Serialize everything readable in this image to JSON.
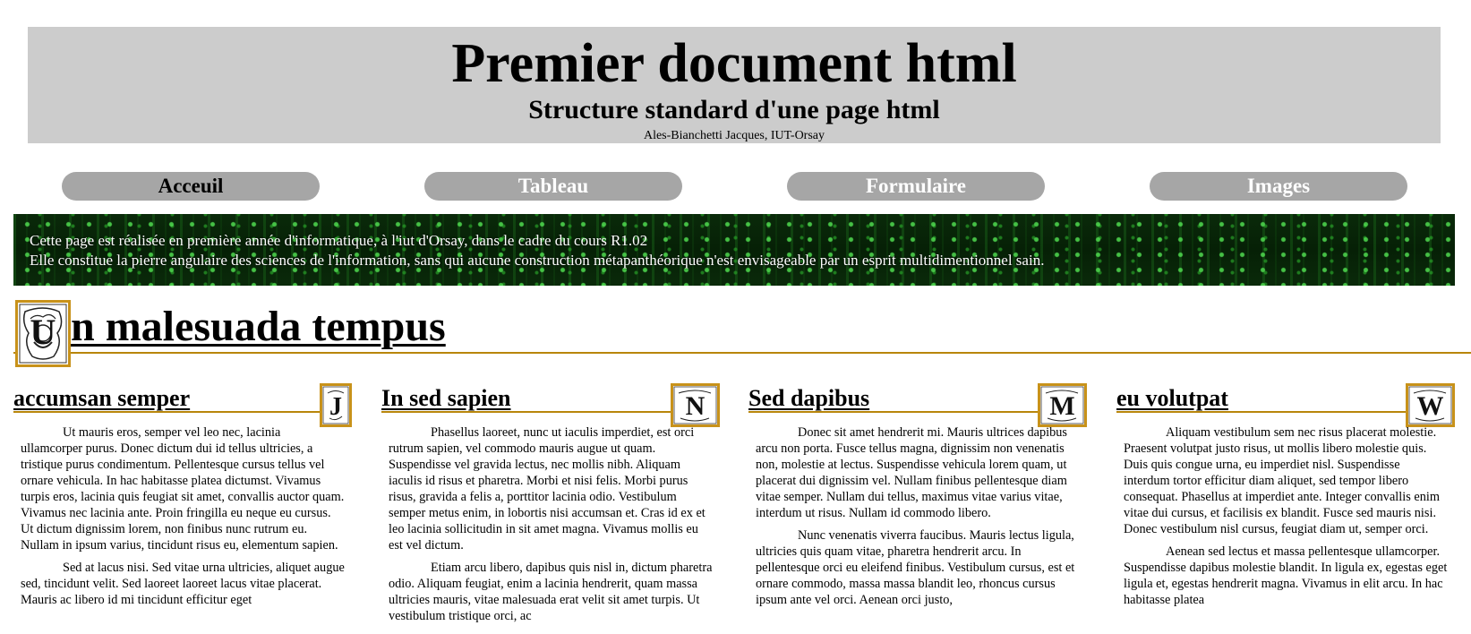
{
  "header": {
    "title": "Premier document html",
    "subtitle": "Structure standard d'une page html",
    "author": "Ales-Bianchetti Jacques, IUT-Orsay"
  },
  "nav": {
    "items": [
      {
        "label": "Acceuil",
        "active": true
      },
      {
        "label": "Tableau",
        "active": false
      },
      {
        "label": "Formulaire",
        "active": false
      },
      {
        "label": "Images",
        "active": false
      }
    ]
  },
  "banner": {
    "line1": "Cette page est réalisée en première année d'informatique, à l'iut d'Orsay, dans le cadre du cours R1.02",
    "line2": "Elle constitue la pierre angulaire des sciences de l'information, sans qui aucune construction métapanthéorique n'est envisageable par un esprit multidimentionnel sain."
  },
  "main": {
    "dropcap": "U",
    "title": "n malesuada tempus"
  },
  "columns": [
    {
      "title": "accumsan semper",
      "dropcap": "J",
      "paragraphs": [
        "Ut mauris eros, semper vel leo nec, lacinia ullamcorper purus. Donec dictum dui id tellus ultricies, a tristique purus condimentum. Pellentesque cursus tellus vel ornare vehicula. In hac habitasse platea dictumst. Vivamus turpis eros, lacinia quis feugiat sit amet, convallis auctor quam. Vivamus nec lacinia ante. Proin fringilla eu neque eu cursus. Ut dictum dignissim lorem, non finibus nunc rutrum eu. Nullam in ipsum varius, tincidunt risus eu, elementum sapien.",
        "Sed at lacus nisi. Sed vitae urna ultricies, aliquet augue sed, tincidunt velit. Sed laoreet laoreet lacus vitae placerat. Mauris ac libero id mi tincidunt efficitur eget"
      ]
    },
    {
      "title": "In sed sapien",
      "dropcap": "N",
      "paragraphs": [
        "Phasellus laoreet, nunc ut iaculis imperdiet, est orci rutrum sapien, vel commodo mauris augue ut quam. Suspendisse vel gravida lectus, nec mollis nibh. Aliquam iaculis id risus et pharetra. Morbi et nisi felis. Morbi purus risus, gravida a felis a, porttitor lacinia odio. Vestibulum semper metus enim, in lobortis nisi accumsan et. Cras id ex et leo lacinia sollicitudin in sit amet magna. Vivamus mollis eu est vel dictum.",
        "Etiam arcu libero, dapibus quis nisl in, dictum pharetra odio. Aliquam feugiat, enim a lacinia hendrerit, quam massa ultricies mauris, vitae malesuada erat velit sit amet turpis. Ut vestibulum tristique orci, ac"
      ]
    },
    {
      "title": "Sed dapibus",
      "dropcap": "M",
      "paragraphs": [
        "Donec sit amet hendrerit mi. Mauris ultrices dapibus arcu non porta. Fusce tellus magna, dignissim non venenatis non, molestie at lectus. Suspendisse vehicula lorem quam, ut placerat dui dignissim vel. Nullam finibus pellentesque diam vitae semper. Nullam dui tellus, maximus vitae varius vitae, interdum ut risus. Nullam id commodo libero.",
        "Nunc venenatis viverra faucibus. Mauris lectus ligula, ultricies quis quam vitae, pharetra hendrerit arcu. In pellentesque orci eu eleifend finibus. Vestibulum cursus, est et ornare commodo, massa massa blandit leo, rhoncus cursus ipsum ante vel orci. Aenean orci justo,"
      ]
    },
    {
      "title": "eu volutpat",
      "dropcap": "W",
      "paragraphs": [
        "Aliquam vestibulum sem nec risus placerat molestie. Praesent volutpat justo risus, ut mollis libero molestie quis. Duis quis congue urna, eu imperdiet nisl. Suspendisse interdum tortor efficitur diam aliquet, sed tempor libero consequat. Phasellus at imperdiet ante. Integer convallis enim vitae dui cursus, et facilisis ex blandit. Fusce sed mauris nisi. Donec vestibulum nisl cursus, feugiat diam ut, semper orci.",
        "Aenean sed lectus et massa pellentesque ullamcorper. Suspendisse dapibus molestie blandit. In ligula ex, egestas eget ligula et, egestas hendrerit magna. Vivamus in elit arcu. In hac habitasse platea"
      ]
    }
  ]
}
